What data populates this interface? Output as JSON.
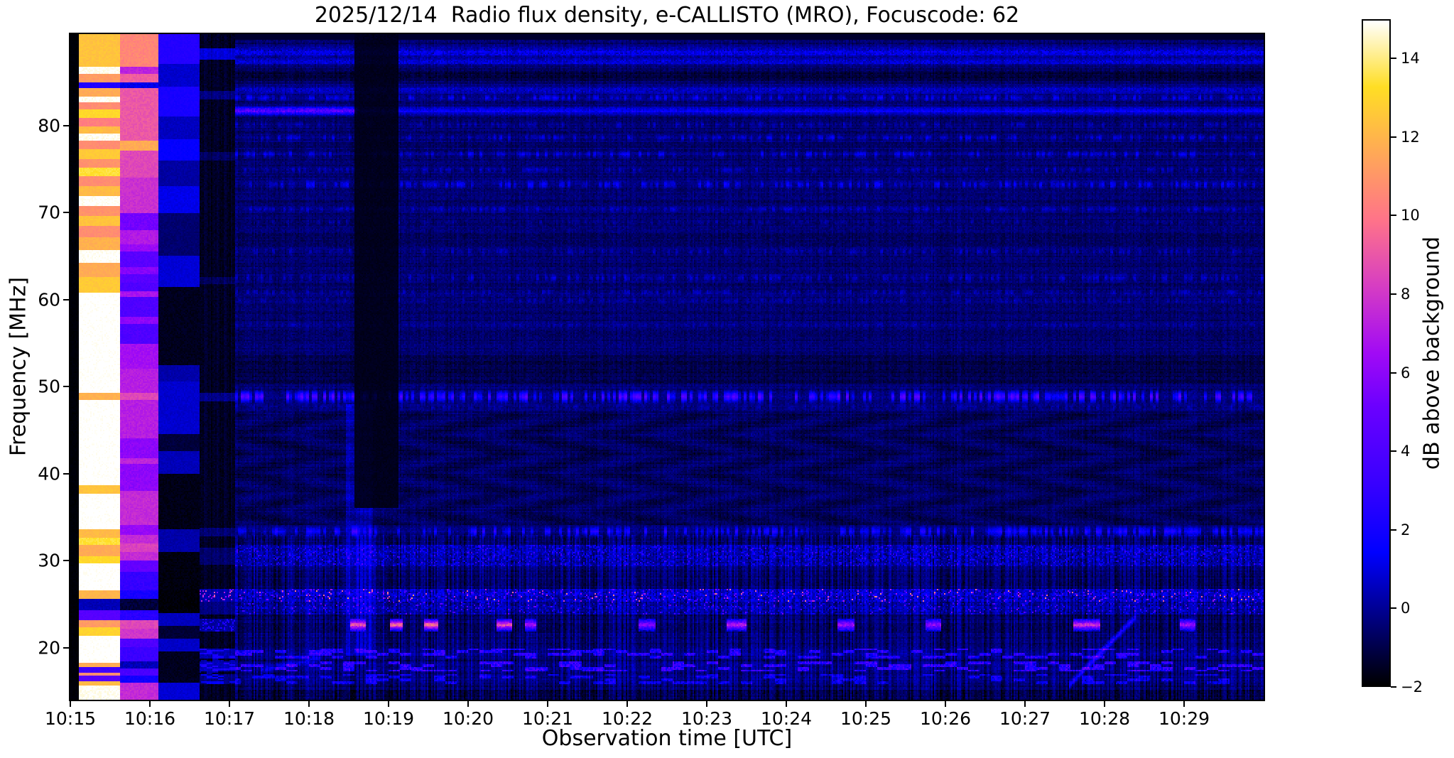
{
  "chart_data": {
    "type": "heatmap",
    "title": "2025/12/14  Radio flux density, e-CALLISTO (MRO), Focuscode: 62",
    "xlabel": "Observation time [UTC]",
    "ylabel": "Frequency [MHz]",
    "colorbar_label": "dB above background",
    "x_tick_labels": [
      "10:15",
      "10:16",
      "10:17",
      "10:18",
      "10:19",
      "10:20",
      "10:21",
      "10:22",
      "10:23",
      "10:24",
      "10:25",
      "10:26",
      "10:27",
      "10:28",
      "10:29"
    ],
    "x_start_utc": "10:15",
    "x_end_utc": "10:30",
    "duration_minutes": 15,
    "y_ticks_mhz": [
      80,
      70,
      60,
      50,
      40,
      30,
      20
    ],
    "freq_range_mhz": [
      14,
      90.5
    ],
    "value_range_db": [
      -2,
      15.4
    ],
    "colorbar_ticks_db": [
      14,
      12,
      10,
      8,
      6,
      4,
      2,
      0,
      -2
    ],
    "colorbar_tick_labels": [
      "14",
      "12",
      "10",
      "8",
      "6",
      "4",
      "2",
      "0",
      "−2"
    ],
    "grid": false,
    "colormap": {
      "name": "gnuplot2-like",
      "stops": [
        [
          0.0,
          "#000000"
        ],
        [
          0.1,
          "#000080"
        ],
        [
          0.2,
          "#0000ff"
        ],
        [
          0.3,
          "#3600ff"
        ],
        [
          0.42,
          "#6b00ff"
        ],
        [
          0.5,
          "#a10af5"
        ],
        [
          0.6,
          "#d63dc3"
        ],
        [
          0.7,
          "#ff7389"
        ],
        [
          0.8,
          "#ffa857"
        ],
        [
          0.9,
          "#ffde24"
        ],
        [
          1.0,
          "#ffffff"
        ]
      ]
    },
    "background_level_db": -0.55,
    "calibration_columns": [
      {
        "name": "black-gap",
        "t_start": 0.0,
        "t_end": 0.115,
        "base_db": -1.9,
        "noise": 0.15,
        "segments": []
      },
      {
        "name": "hot-calibration-white",
        "t_start": 0.115,
        "t_end": 0.62,
        "base_db": 15.2,
        "noise": 0.5,
        "segments": [
          [
            86.8,
            90.5,
            12.8
          ],
          [
            85.9,
            86.8,
            15.3
          ],
          [
            85.0,
            85.9,
            11.5
          ],
          [
            84.3,
            85.0,
            2.5
          ],
          [
            83.4,
            84.3,
            12.0
          ],
          [
            82.7,
            83.4,
            15.3
          ],
          [
            81.9,
            82.7,
            11.0
          ],
          [
            80.9,
            81.9,
            13.5
          ],
          [
            79.9,
            80.9,
            10.5
          ],
          [
            79.1,
            79.9,
            12.5
          ],
          [
            78.3,
            79.1,
            15.3
          ],
          [
            77.3,
            78.3,
            11.0
          ],
          [
            76.2,
            77.3,
            13.0
          ],
          [
            75.2,
            76.2,
            11.2
          ],
          [
            74.2,
            75.2,
            13.8
          ],
          [
            73.1,
            74.2,
            11.0
          ],
          [
            71.9,
            73.1,
            12.5
          ],
          [
            70.7,
            71.9,
            15.4
          ],
          [
            69.6,
            70.7,
            11.2
          ],
          [
            68.4,
            69.6,
            12.8
          ],
          [
            67.1,
            68.4,
            11.0
          ],
          [
            65.7,
            67.1,
            12.2
          ],
          [
            64.2,
            65.7,
            15.4
          ],
          [
            62.6,
            64.2,
            12.0
          ],
          [
            60.8,
            62.6,
            13.0
          ],
          [
            49.3,
            60.8,
            15.5
          ],
          [
            48.4,
            49.3,
            12.2
          ],
          [
            38.6,
            48.4,
            15.5
          ],
          [
            37.6,
            38.6,
            12.8
          ],
          [
            33.6,
            37.6,
            15.5
          ],
          [
            32.6,
            33.6,
            12.5
          ],
          [
            31.8,
            32.6,
            13.8
          ],
          [
            30.4,
            31.8,
            12.0
          ],
          [
            29.6,
            30.4,
            13.5
          ],
          [
            26.5,
            29.6,
            15.5
          ],
          [
            25.5,
            26.5,
            12.3
          ],
          [
            24.2,
            25.5,
            0.5
          ],
          [
            23.2,
            24.2,
            4.5
          ],
          [
            22.4,
            23.2,
            11.5
          ],
          [
            21.4,
            22.4,
            13.3
          ],
          [
            18.3,
            21.4,
            15.5
          ],
          [
            17.8,
            18.3,
            12.0
          ],
          [
            17.1,
            17.8,
            3.5
          ],
          [
            16.7,
            17.1,
            11.0
          ],
          [
            16.2,
            16.7,
            4.5
          ],
          [
            15.6,
            16.2,
            12.5
          ],
          [
            14.0,
            15.6,
            15.3
          ]
        ]
      },
      {
        "name": "warm-calibration-pink",
        "t_start": 0.62,
        "t_end": 1.11,
        "base_db": 7.2,
        "noise": 0.7,
        "segments": [
          [
            86.8,
            90.5,
            10.8
          ],
          [
            85.9,
            86.8,
            7.5
          ],
          [
            85.0,
            85.9,
            9.5
          ],
          [
            84.3,
            85.0,
            1.2
          ],
          [
            78.3,
            84.3,
            9.3
          ],
          [
            77.2,
            78.3,
            12.0
          ],
          [
            74.0,
            77.2,
            8.8
          ],
          [
            70.0,
            74.0,
            8.0
          ],
          [
            68.0,
            70.0,
            5.5
          ],
          [
            65.5,
            66.3,
            6.5
          ],
          [
            63.0,
            63.8,
            6.0
          ],
          [
            62.0,
            65.5,
            4.6
          ],
          [
            60.3,
            61.0,
            7.0
          ],
          [
            57.2,
            58.0,
            6.2
          ],
          [
            55.0,
            62.0,
            4.2
          ],
          [
            52.0,
            55.0,
            6.8
          ],
          [
            48.4,
            49.3,
            8.8
          ],
          [
            44.0,
            52.0,
            7.4
          ],
          [
            41.0,
            41.8,
            7.6
          ],
          [
            38.0,
            44.0,
            6.2
          ],
          [
            33.0,
            34.0,
            6.4
          ],
          [
            31.0,
            32.0,
            8.6
          ],
          [
            30.0,
            38.0,
            7.8
          ],
          [
            28.6,
            30.0,
            5.0
          ],
          [
            26.5,
            28.6,
            3.2
          ],
          [
            25.5,
            26.5,
            2.2
          ],
          [
            24.2,
            25.5,
            -1.2
          ],
          [
            23.2,
            24.2,
            2.8
          ],
          [
            22.2,
            23.2,
            8.8
          ],
          [
            21.0,
            22.2,
            8.2
          ],
          [
            20.0,
            21.0,
            4.2
          ],
          [
            18.4,
            20.0,
            3.4
          ],
          [
            17.6,
            18.4,
            0.5
          ],
          [
            16.8,
            17.6,
            4.0
          ],
          [
            15.9,
            16.8,
            2.0
          ],
          [
            14.0,
            15.9,
            7.8
          ]
        ]
      },
      {
        "name": "cold-calibration-blue",
        "t_start": 1.11,
        "t_end": 1.63,
        "base_db": -0.3,
        "noise": 0.4,
        "segments": [
          [
            87.0,
            90.5,
            2.6
          ],
          [
            84.5,
            87.0,
            0.8
          ],
          [
            81.0,
            84.5,
            2.2
          ],
          [
            78.5,
            81.0,
            0.6
          ],
          [
            76.0,
            78.5,
            1.6
          ],
          [
            73.0,
            76.0,
            0.2
          ],
          [
            70.0,
            73.0,
            1.2
          ],
          [
            65.0,
            70.0,
            -0.5
          ],
          [
            61.5,
            65.0,
            0.9
          ],
          [
            52.5,
            61.5,
            -1.6
          ],
          [
            50.5,
            52.5,
            0.3
          ],
          [
            44.5,
            50.5,
            0.8
          ],
          [
            42.5,
            44.5,
            -1.2
          ],
          [
            40.0,
            42.5,
            0.5
          ],
          [
            33.5,
            40.0,
            -1.7
          ],
          [
            31.0,
            33.5,
            0.3
          ],
          [
            26.5,
            31.0,
            -1.8
          ],
          [
            24.0,
            26.5,
            -1.9
          ],
          [
            22.5,
            24.0,
            0.6
          ],
          [
            21.0,
            22.5,
            -1.3
          ],
          [
            19.6,
            21.0,
            0.7
          ],
          [
            16.0,
            19.6,
            -1.6
          ],
          [
            14.0,
            16.0,
            0.9
          ]
        ]
      },
      {
        "name": "dark-settle-column",
        "t_start": 1.63,
        "t_end": 2.08,
        "base_db": -1.55,
        "noise": 0.5,
        "segments": [
          [
            87.5,
            88.8,
            0.9
          ],
          [
            83.0,
            84.0,
            -0.3
          ],
          [
            76.0,
            77.0,
            -0.7
          ],
          [
            61.8,
            62.6,
            -0.8
          ],
          [
            48.3,
            49.2,
            -0.2
          ],
          [
            32.8,
            33.8,
            -0.5
          ],
          [
            29.5,
            31.5,
            -0.6
          ],
          [
            25.2,
            26.7,
            0.3
          ],
          [
            23.8,
            25.2,
            -0.3
          ],
          [
            21.9,
            23.3,
            0.1
          ],
          [
            18.8,
            19.9,
            0.3
          ],
          [
            17.2,
            18.4,
            0.5
          ],
          [
            15.8,
            16.9,
            -0.3
          ]
        ]
      }
    ],
    "spectral_lines": [
      {
        "f": 88.4,
        "hw": 0.55,
        "amp": 1.7,
        "style": "textured"
      },
      {
        "f": 87.3,
        "hw": 0.35,
        "amp": 1.4,
        "style": "textured"
      },
      {
        "f": 85.8,
        "hw": 0.6,
        "amp": -0.7,
        "style": "dark"
      },
      {
        "f": 84.1,
        "hw": 0.5,
        "amp": 1.1,
        "style": "textured"
      },
      {
        "f": 83.2,
        "hw": 0.3,
        "amp": 1.5,
        "style": "dotted"
      },
      {
        "f": 81.7,
        "hw": 0.4,
        "amp": 2.1,
        "style": "line",
        "enhanced_until_min": 3.6,
        "enhanced_amp": 5.2
      },
      {
        "f": 80.1,
        "hw": 0.35,
        "amp": 0.8,
        "style": "dotted"
      },
      {
        "f": 78.6,
        "hw": 0.35,
        "amp": 1.2,
        "style": "dotted"
      },
      {
        "f": 76.7,
        "hw": 0.4,
        "amp": 1.3,
        "style": "dotted"
      },
      {
        "f": 74.9,
        "hw": 0.3,
        "amp": 0.9,
        "style": "dotted"
      },
      {
        "f": 73.2,
        "hw": 0.4,
        "amp": 1.5,
        "style": "dotted"
      },
      {
        "f": 70.4,
        "hw": 0.3,
        "amp": 0.8,
        "style": "dotted"
      },
      {
        "f": 68.9,
        "hw": 0.3,
        "amp": 0.6,
        "style": "dotted"
      },
      {
        "f": 65.5,
        "hw": 0.35,
        "amp": 0.8,
        "style": "dotted"
      },
      {
        "f": 62.5,
        "hw": 0.4,
        "amp": 1.0,
        "style": "dotted"
      },
      {
        "f": 60.9,
        "hw": 0.3,
        "amp": 0.8,
        "style": "dotted"
      },
      {
        "f": 59.9,
        "hw": 0.3,
        "amp": 0.6,
        "style": "dotted"
      },
      {
        "f": 57.1,
        "hw": 0.3,
        "amp": 0.5,
        "style": "dotted"
      },
      {
        "f": 48.8,
        "hw": 0.55,
        "amp": 2.3,
        "style": "bright-dotted"
      },
      {
        "f": 47.6,
        "hw": 0.3,
        "amp": 0.6,
        "style": "dotted"
      },
      {
        "f": 33.3,
        "hw": 0.5,
        "amp": 1.4,
        "style": "bright-dotted"
      }
    ],
    "rfi_bands": [
      {
        "f_low": 29.3,
        "f_high": 31.8,
        "base_amp": 1.0,
        "spike_amp": 2.4,
        "spike_prob": 0.1,
        "style": "speckle"
      },
      {
        "f_low": 25.2,
        "f_high": 26.7,
        "base_amp": 1.5,
        "spike_amp": 8.5,
        "spike_prob": 0.045,
        "style": "speckle"
      },
      {
        "f_low": 23.8,
        "f_high": 25.2,
        "base_amp": 0.9,
        "spike_amp": 4.0,
        "spike_prob": 0.05,
        "style": "speckle"
      },
      {
        "f_low": 18.8,
        "f_high": 19.9,
        "base_amp": 0.9,
        "spike_amp": 2.6,
        "spike_prob": 0.3,
        "style": "streaks"
      },
      {
        "f_low": 17.2,
        "f_high": 18.4,
        "base_amp": 1.0,
        "spike_amp": 3.0,
        "spike_prob": 0.33,
        "style": "streaks"
      },
      {
        "f_low": 15.8,
        "f_high": 16.9,
        "base_amp": 0.5,
        "spike_amp": 1.8,
        "spike_prob": 0.25,
        "style": "streaks"
      }
    ],
    "burst_segments_22mhz": {
      "f_low": 21.9,
      "f_high": 23.3,
      "f_center": 22.6,
      "segments": [
        [
          3.52,
          3.72,
          8.5
        ],
        [
          4.02,
          4.18,
          10.5
        ],
        [
          4.45,
          4.63,
          11.0
        ],
        [
          5.35,
          5.55,
          9.5
        ],
        [
          5.72,
          5.86,
          7.0
        ],
        [
          7.15,
          7.35,
          6.0
        ],
        [
          8.25,
          8.5,
          8.0
        ],
        [
          9.65,
          9.85,
          7.0
        ],
        [
          10.75,
          10.95,
          6.5
        ],
        [
          12.6,
          12.95,
          8.5
        ],
        [
          13.95,
          14.15,
          7.0
        ]
      ]
    },
    "dark_zones": [
      {
        "f_low": 50.3,
        "f_high": 53.6,
        "amp": -0.45,
        "wavy": false
      },
      {
        "f_low": 34.0,
        "f_high": 47.0,
        "amp": -0.2,
        "wavy": true
      }
    ],
    "vertical_events": [
      {
        "t_start": 3.58,
        "t_end": 4.12,
        "f_low": 36.0,
        "f_high": 90.5,
        "type": "dropout"
      },
      {
        "t_start": 3.46,
        "t_end": 3.8,
        "f_low": 19.0,
        "f_high": 48.0,
        "type": "enhancement",
        "amp": 1.1
      }
    ],
    "drift_features": [
      {
        "t0": 12.55,
        "f0": 15.6,
        "t1": 13.4,
        "f1": 23.6,
        "amp": 3.2
      },
      {
        "t0": 2.4,
        "f0": 17.4,
        "t1": 3.15,
        "f1": 18.8,
        "amp": 1.8
      }
    ],
    "top_dark_band_above_mhz": 89.9,
    "bottom_dim_below_mhz": 15.1
  }
}
